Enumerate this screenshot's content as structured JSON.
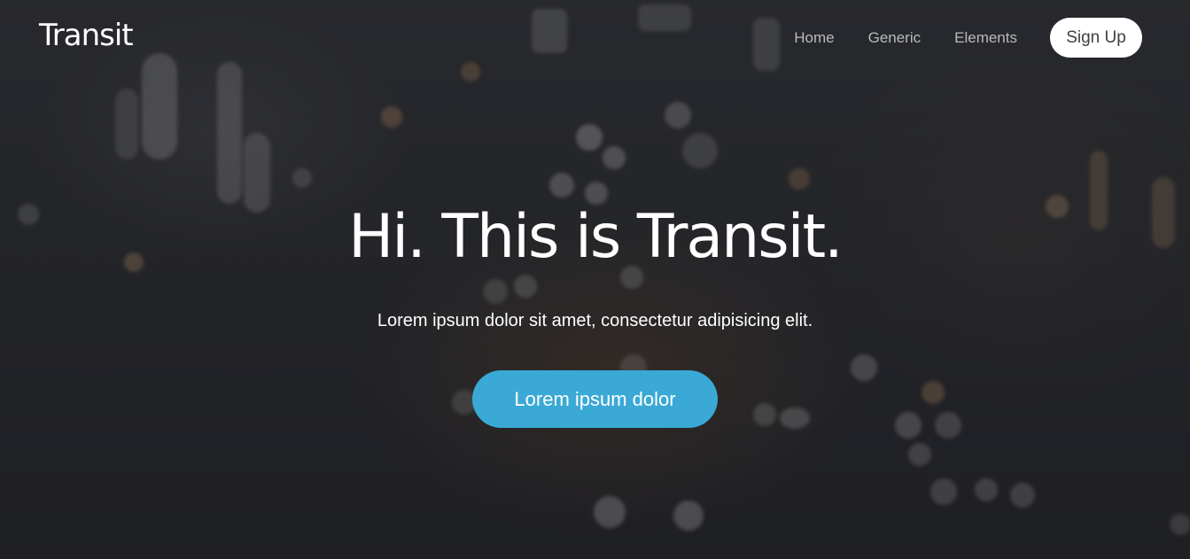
{
  "header": {
    "logo": "Transit",
    "nav": {
      "home": "Home",
      "generic": "Generic",
      "elements": "Elements"
    },
    "signup_label": "Sign Up"
  },
  "hero": {
    "title": "Hi. This is Transit.",
    "subtitle": "Lorem ipsum dolor sit amet, consectetur adipisicing elit.",
    "cta_label": "Lorem ipsum dolor"
  },
  "colors": {
    "accent": "#3aa9d5",
    "background": "#25272b"
  }
}
